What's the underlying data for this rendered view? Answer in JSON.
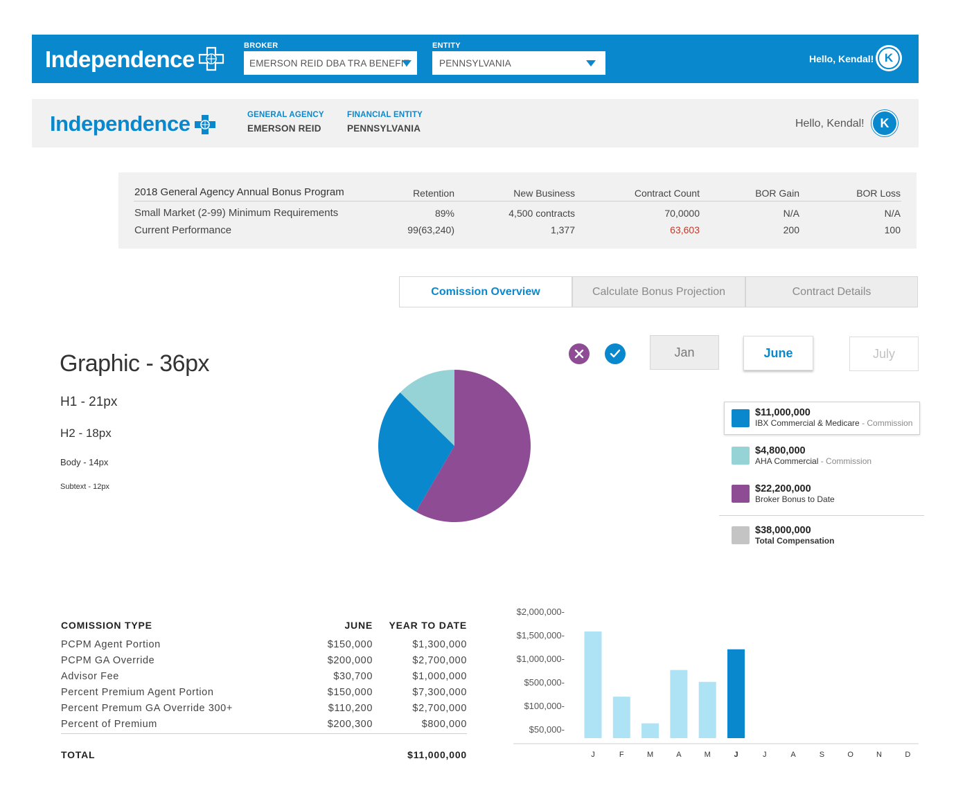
{
  "header_primary": {
    "logo_text": "Independence",
    "broker_label": "BROKER",
    "broker_value": "EMERSON REID DBA TRA BENEFIT",
    "entity_label": "ENTITY",
    "entity_value": "PENNSYLVANIA",
    "greeting": "Hello, Kendal!",
    "avatar_initial": "K"
  },
  "header_secondary": {
    "logo_text": "Independence",
    "agency_label": "GENERAL AGENCY",
    "agency_value": "EMERSON REID",
    "entity_label": "FINANCIAL ENTITY",
    "entity_value": "PENNSYLVANIA",
    "greeting": "Hello, Kendal!",
    "avatar_initial": "K"
  },
  "bonus_program": {
    "title": "2018 General Agency Annual Bonus Program",
    "columns": [
      "Retention",
      "New Business",
      "Contract Count",
      "BOR Gain",
      "BOR Loss"
    ],
    "rows": [
      {
        "label": "Small Market (2-99) Minimum Requirements",
        "values": [
          "89%",
          "4,500 contracts",
          "70,0000",
          "N/A",
          "N/A"
        ]
      },
      {
        "label": "Current Performance",
        "values": [
          "99(63,240)",
          "1,377",
          "63,603",
          "200",
          "100"
        ]
      }
    ],
    "highlight_color": "#c0392b"
  },
  "tabs": [
    {
      "label": "Comission Overview",
      "active": true
    },
    {
      "label": "Calculate Bonus Projection",
      "active": false
    },
    {
      "label": "Contract Details",
      "active": false
    }
  ],
  "typography": {
    "graphic": "Graphic - 36px",
    "h1": "H1 - 21px",
    "h2": "H2 - 18px",
    "body": "Body - 14px",
    "subtext": "Subtext - 12px"
  },
  "controls": {
    "cancel_icon": "close-icon",
    "confirm_icon": "check-icon",
    "months": [
      {
        "label": "Jan",
        "state": "default"
      },
      {
        "label": "June",
        "state": "selected"
      },
      {
        "label": "July",
        "state": "disabled"
      }
    ]
  },
  "legend": [
    {
      "amount": "$11,000,000",
      "label": "IBX Commercial & Medicare",
      "suffix": "- Commission",
      "color": "#0a88cd",
      "selected": true
    },
    {
      "amount": "$4,800,000",
      "label": "AHA Commercial",
      "suffix": "- Commission",
      "color": "#95d3d6",
      "selected": false
    },
    {
      "amount": "$22,200,000",
      "label": "Broker Bonus to Date",
      "suffix": "",
      "color": "#8e4c94",
      "selected": false
    },
    {
      "amount": "$38,000,000",
      "label": "Total Compensation",
      "suffix": "",
      "color": "#c4c4c4",
      "selected": false
    }
  ],
  "chart_data": [
    {
      "type": "pie",
      "categories": [
        "AHA Commercial",
        "IBX Commercial & Medicare",
        "Broker Bonus to Date"
      ],
      "values": [
        4800000,
        11000000,
        22200000
      ],
      "colors": [
        "#95d3d6",
        "#0a88cd",
        "#8e4c94"
      ]
    },
    {
      "type": "bar",
      "categories": [
        "J",
        "F",
        "M",
        "A",
        "M",
        "J",
        "J",
        "A",
        "S",
        "O",
        "N",
        "D"
      ],
      "values": [
        1800000,
        700000,
        250000,
        1150000,
        950000,
        1500000,
        null,
        null,
        null,
        null,
        null,
        null
      ],
      "highlight_index": 5,
      "y_ticks": [
        "$2,000,000-",
        "$1,500,000-",
        "$1,000,000-",
        "$500,000-",
        "$100,000-",
        "$50,000-"
      ],
      "ylim": [
        0,
        2000000
      ],
      "bar_color": "#aee3f5",
      "highlight_color": "#0a88cd"
    }
  ],
  "commission_table": {
    "headers": [
      "COMISSION TYPE",
      "JUNE",
      "YEAR TO DATE"
    ],
    "rows": [
      [
        "PCPM Agent Portion",
        "$150,000",
        "$1,300,000"
      ],
      [
        "PCPM GA Override",
        "$200,000",
        "$2,700,000"
      ],
      [
        "Advisor Fee",
        "$30,700",
        "$1,000,000"
      ],
      [
        "Percent Premium Agent Portion",
        "$150,000",
        "$7,300,000"
      ],
      [
        "Percent Premum GA Override 300+",
        "$110,200",
        "$2,700,000"
      ],
      [
        "Percent of Premium",
        "$200,300",
        "$800,000"
      ]
    ],
    "total_label": "TOTAL",
    "total_value": "$11,000,000"
  }
}
